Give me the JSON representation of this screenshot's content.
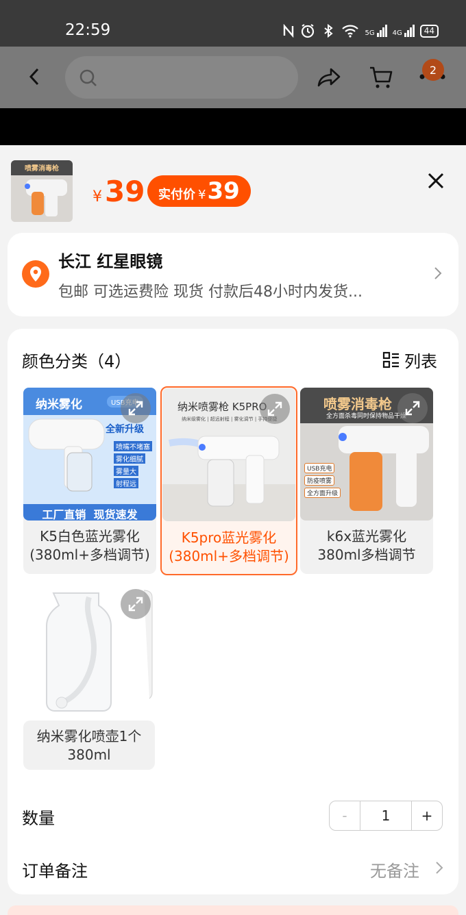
{
  "status_bar": {
    "time": "22:59",
    "network_5g": "5G",
    "network_4g": "4G",
    "battery": "44"
  },
  "nav": {
    "cart_badge": "2"
  },
  "product": {
    "price_currency": "¥",
    "price": "39",
    "real_price_label": "实付价",
    "real_price_currency": "¥",
    "real_price": "39",
    "thumb_caption": "喷雾消毒枪"
  },
  "address": {
    "name": "长江 红星眼镜",
    "desc": "包邮  可选运费险  现货 付款后48小时内发货..."
  },
  "sku": {
    "title": "颜色分类（4）",
    "list_toggle_label": "列表",
    "options": [
      {
        "label": "K5白色蓝光雾化\n(380ml+多档调节)",
        "img_title": "纳米雾化",
        "img_tag": "USB充电",
        "img_sub": "全新升级",
        "img_bullets": [
          "喷嘴不堵塞",
          "雾化细腻",
          "雾量大",
          "射程远"
        ],
        "img_footer": "工厂直销  现货速发",
        "selected": false
      },
      {
        "label": "K5pro蓝光雾化\n(380ml+多档调节)",
        "img_title": "纳米喷雾枪 K5PRO",
        "img_sub": "纳米级雾化 | 超远射程 | 雾化调节 | 手持便捷",
        "selected": true
      },
      {
        "label": "k6x蓝光雾化\n380ml多档调节",
        "img_title": "喷雾消毒枪",
        "img_sub": "全方面杀毒同时保持物品干燥",
        "img_tags": [
          "USB充电",
          "防疫喷雾",
          "全方面升级"
        ],
        "selected": false
      },
      {
        "label": "纳米雾化喷壶1个\n380ml",
        "selected": false
      }
    ]
  },
  "quantity": {
    "label": "数量",
    "minus": "-",
    "value": "1",
    "plus": "+"
  },
  "note": {
    "label": "订单备注",
    "value": "无备注"
  },
  "colors": {
    "accent": "#ff5000",
    "selected_border": "#ff6a2a"
  }
}
